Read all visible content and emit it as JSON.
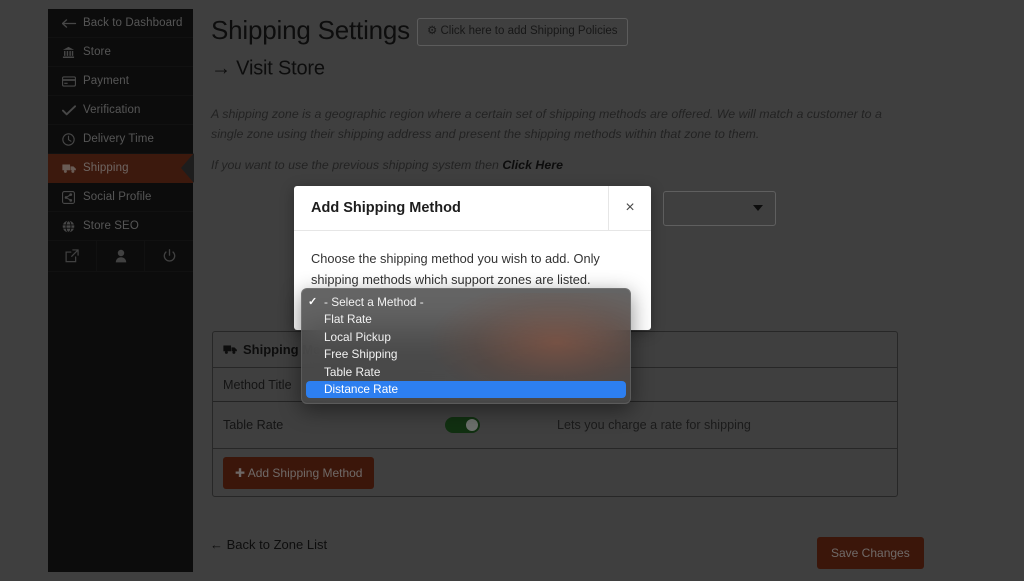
{
  "sidebar": {
    "items": [
      {
        "label": "Back to Dashboard",
        "icon": "arrow-left-icon",
        "active": false
      },
      {
        "label": "Store",
        "icon": "bank-icon",
        "active": false
      },
      {
        "label": "Payment",
        "icon": "credit-card-icon",
        "active": false
      },
      {
        "label": "Verification",
        "icon": "check-icon",
        "active": false
      },
      {
        "label": "Delivery Time",
        "icon": "clock-icon",
        "active": false
      },
      {
        "label": "Shipping",
        "icon": "truck-icon",
        "active": true
      },
      {
        "label": "Social Profile",
        "icon": "share-icon",
        "active": false
      },
      {
        "label": "Store SEO",
        "icon": "globe-icon",
        "active": false
      }
    ],
    "footer_icons": [
      "external-link-icon",
      "user-icon",
      "power-icon"
    ]
  },
  "header": {
    "title": "Shipping Settings",
    "policies_button": "Click here to add Shipping Policies",
    "policies_icon": "gear-icon",
    "visit_link": "Visit Store",
    "visit_arrow": "→"
  },
  "description": {
    "paragraph": "A shipping zone is a geographic region where a certain set of shipping methods are offered. We will match a customer to a single zone using their shipping address and present the shipping methods within that zone to them.",
    "prev_system_prefix": "If you want to use the previous shipping system then ",
    "prev_system_link": "Click Here"
  },
  "zone_form": {
    "region_select_value": "",
    "region_caret": "caret-down-icon"
  },
  "methods_panel": {
    "heading": "Shipping Methods",
    "heading_icon": "truck-icon",
    "rows": [
      {
        "label": "Method Title",
        "control": "text-input",
        "value": "",
        "hint": ""
      },
      {
        "label": "Table Rate",
        "control": "toggle",
        "value": "on",
        "hint": "Lets you charge a rate for shipping"
      }
    ],
    "add_button": "Add Shipping Method",
    "add_button_icon": "plus-icon"
  },
  "footer": {
    "back_link": "Back to Zone List",
    "back_arrow": "←",
    "save_button": "Save Changes"
  },
  "modal": {
    "title": "Add Shipping Method",
    "close_icon": "close-icon",
    "body": "Choose the shipping method you wish to add. Only shipping methods which support zones are listed."
  },
  "select_popup": {
    "check_glyph": "✓",
    "options": [
      {
        "label": "- Select a Method -",
        "checked": true,
        "highlighted": false
      },
      {
        "label": "Flat Rate",
        "checked": false,
        "highlighted": false
      },
      {
        "label": "Local Pickup",
        "checked": false,
        "highlighted": false
      },
      {
        "label": "Free Shipping",
        "checked": false,
        "highlighted": false
      },
      {
        "label": "Table Rate",
        "checked": false,
        "highlighted": false
      },
      {
        "label": "Distance Rate",
        "checked": false,
        "highlighted": true
      }
    ]
  },
  "colors": {
    "accent": "#8b2d0f",
    "sidebar_bg": "#1b1b1b",
    "highlight_blue": "#2d7ff0",
    "toggle_on": "#1d6b1d",
    "page_bg": "#3f3f3f"
  }
}
